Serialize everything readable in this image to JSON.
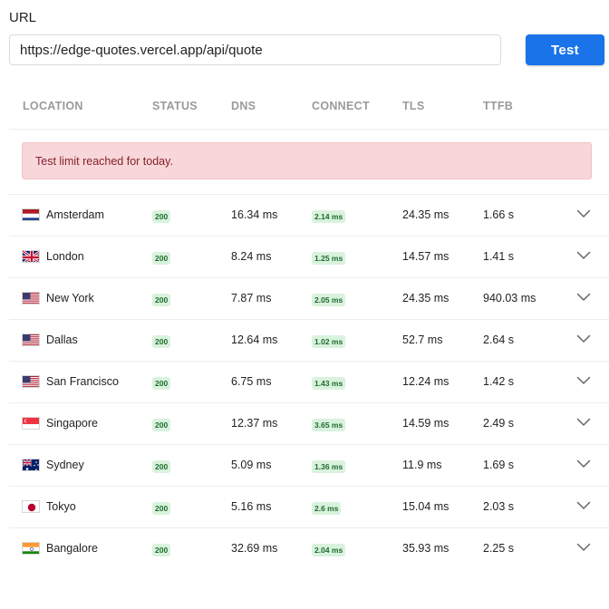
{
  "form": {
    "url_label": "URL",
    "url_value": "https://edge-quotes.vercel.app/api/quote",
    "test_button_label": "Test"
  },
  "table": {
    "columns": [
      "LOCATION",
      "STATUS",
      "DNS",
      "CONNECT",
      "TLS",
      "TTFB"
    ],
    "alert": "Test limit reached for today.",
    "rows": [
      {
        "flag": "netherlands-flag-icon",
        "location": "Amsterdam",
        "status": "200",
        "dns": "16.34 ms",
        "connect": "2.14 ms",
        "tls": "24.35 ms",
        "ttfb": "1.66 s"
      },
      {
        "flag": "uk-flag-icon",
        "location": "London",
        "status": "200",
        "dns": "8.24 ms",
        "connect": "1.25 ms",
        "tls": "14.57 ms",
        "ttfb": "1.41 s"
      },
      {
        "flag": "us-flag-icon",
        "location": "New York",
        "status": "200",
        "dns": "7.87 ms",
        "connect": "2.05 ms",
        "tls": "24.35 ms",
        "ttfb": "940.03 ms"
      },
      {
        "flag": "us-flag-icon",
        "location": "Dallas",
        "status": "200",
        "dns": "12.64 ms",
        "connect": "1.02 ms",
        "tls": "52.7 ms",
        "ttfb": "2.64 s"
      },
      {
        "flag": "us-flag-icon",
        "location": "San Francisco",
        "status": "200",
        "dns": "6.75 ms",
        "connect": "1.43 ms",
        "tls": "12.24 ms",
        "ttfb": "1.42 s"
      },
      {
        "flag": "singapore-flag-icon",
        "location": "Singapore",
        "status": "200",
        "dns": "12.37 ms",
        "connect": "3.65 ms",
        "tls": "14.59 ms",
        "ttfb": "2.49 s"
      },
      {
        "flag": "australia-flag-icon",
        "location": "Sydney",
        "status": "200",
        "dns": "5.09 ms",
        "connect": "1.36 ms",
        "tls": "11.9 ms",
        "ttfb": "1.69 s"
      },
      {
        "flag": "japan-flag-icon",
        "location": "Tokyo",
        "status": "200",
        "dns": "5.16 ms",
        "connect": "2.6 ms",
        "tls": "15.04 ms",
        "ttfb": "2.03 s"
      },
      {
        "flag": "india-flag-icon",
        "location": "Bangalore",
        "status": "200",
        "dns": "32.69 ms",
        "connect": "2.04 ms",
        "tls": "35.93 ms",
        "ttfb": "2.25 s"
      }
    ]
  },
  "colors": {
    "accent": "#1a73e8",
    "alert_bg": "#f8d7da",
    "alert_text": "#842029",
    "badge_bg": "#d9f2dd",
    "badge_text": "#1e6b2e"
  }
}
